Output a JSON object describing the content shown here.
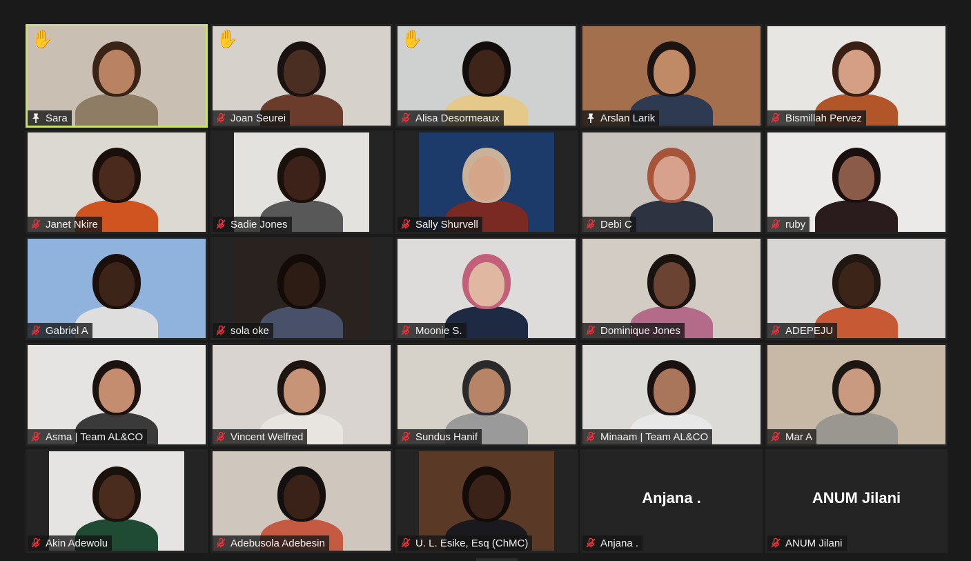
{
  "meeting": {
    "view": "Gallery View",
    "accent_speaking": "#c8e26a"
  },
  "participants": [
    {
      "name": "Sara",
      "status_icon": "pin-icon",
      "hand_raised": true,
      "speaking": true,
      "video": true,
      "bg": "#c9bfb3",
      "skin": "#b98262",
      "hair": "#3a2418",
      "shirt": "#8f7c64"
    },
    {
      "name": "Joan Seurei",
      "status_icon": "mic-muted-icon",
      "hand_raised": true,
      "speaking": false,
      "video": true,
      "bg": "#d6d2cb",
      "skin": "#4a2e22",
      "hair": "#1a1210",
      "shirt": "#6b3b2b"
    },
    {
      "name": "Alisa Desormeaux",
      "status_icon": "mic-muted-icon",
      "hand_raised": true,
      "speaking": false,
      "video": true,
      "bg": "#cfd1d1",
      "skin": "#3e2419",
      "hair": "#120c0a",
      "shirt": "#e4c98a"
    },
    {
      "name": "Arslan Larik",
      "status_icon": "pin-icon",
      "hand_raised": false,
      "speaking": false,
      "video": true,
      "bg": "#a46f4d",
      "skin": "#c08a66",
      "hair": "#1c1410",
      "shirt": "#2e3a52"
    },
    {
      "name": "Bismillah Pervez",
      "status_icon": "mic-muted-icon",
      "hand_raised": false,
      "speaking": false,
      "video": true,
      "bg": "#e8e6e3",
      "skin": "#d59f86",
      "hair": "#3a2014",
      "shirt": "#b2562a"
    },
    {
      "name": "Janet Nkire",
      "status_icon": "mic-muted-icon",
      "hand_raised": false,
      "speaking": false,
      "video": true,
      "bg": "#dcd8d2",
      "skin": "#4a2a1c",
      "hair": "#1a0f0b",
      "shirt": "#d0541f"
    },
    {
      "name": "Sadie Jones",
      "status_icon": "mic-muted-icon",
      "hand_raised": false,
      "speaking": false,
      "video": true,
      "narrow": true,
      "bg": "#e4e2de",
      "skin": "#3c2218",
      "hair": "#1a100c",
      "shirt": "#585858"
    },
    {
      "name": "Sally Shurvell",
      "status_icon": "mic-muted-icon",
      "hand_raised": false,
      "speaking": false,
      "video": true,
      "narrow": true,
      "bg": "#1c3a6a",
      "skin": "#d5a58a",
      "hair": "#c9b299",
      "shirt": "#7a2a22"
    },
    {
      "name": "Debi C",
      "status_icon": "mic-muted-icon",
      "hand_raised": false,
      "speaking": false,
      "video": true,
      "bg": "#c8c4bd",
      "skin": "#d8a18e",
      "hair": "#a6553a",
      "shirt": "#2d3340"
    },
    {
      "name": "ruby",
      "status_icon": "mic-muted-icon",
      "hand_raised": false,
      "speaking": false,
      "video": true,
      "bg": "#eceae8",
      "skin": "#8a5b49",
      "hair": "#1a0f0f",
      "shirt": "#2a1c1c"
    },
    {
      "name": "Gabriel A",
      "status_icon": "mic-muted-icon",
      "hand_raised": false,
      "speaking": false,
      "video": true,
      "bg": "#8fb3dc",
      "skin": "#3d2418",
      "hair": "#1a0f0b",
      "shirt": "#dedede"
    },
    {
      "name": "sola oke",
      "status_icon": "mic-muted-icon",
      "hand_raised": false,
      "speaking": false,
      "video": true,
      "narrow": true,
      "bg": "#2a221e",
      "skin": "#2d1c14",
      "hair": "#120b08",
      "shirt": "#48506a"
    },
    {
      "name": "Moonie S.",
      "status_icon": "mic-muted-icon",
      "hand_raised": false,
      "speaking": false,
      "video": true,
      "bg": "#dedcda",
      "skin": "#e0b7a1",
      "hair": "#c2607a",
      "shirt": "#1e2a44"
    },
    {
      "name": "Dominique Jones",
      "status_icon": "mic-muted-icon",
      "hand_raised": false,
      "speaking": false,
      "video": true,
      "bg": "#d2ccc4",
      "skin": "#6a4332",
      "hair": "#1a120e",
      "shirt": "#b46b8a"
    },
    {
      "name": "ADEPEJU",
      "status_icon": "mic-muted-icon",
      "hand_raised": false,
      "speaking": false,
      "video": true,
      "bg": "#d8d6d4",
      "skin": "#3c2418",
      "hair": "#201612",
      "shirt": "#c75a34"
    },
    {
      "name": "Asma | Team AL&CO",
      "status_icon": "mic-muted-icon",
      "hand_raised": false,
      "speaking": false,
      "video": true,
      "bg": "#e6e4e2",
      "skin": "#c48d70",
      "hair": "#1c1210",
      "shirt": "#3a3a3a"
    },
    {
      "name": "Vincent Welfred",
      "status_icon": "mic-muted-icon",
      "hand_raised": false,
      "speaking": false,
      "video": true,
      "bg": "#d9d4cf",
      "skin": "#c89478",
      "hair": "#1e1410",
      "shirt": "#e8e4e0"
    },
    {
      "name": "Sundus Hanif",
      "status_icon": "mic-muted-icon",
      "hand_raised": false,
      "speaking": false,
      "video": true,
      "bg": "#d6d2ca",
      "skin": "#b88468",
      "hair": "#2a2a2a",
      "shirt": "#9a9a9a"
    },
    {
      "name": "Minaam | Team AL&CO",
      "status_icon": "mic-muted-icon",
      "hand_raised": false,
      "speaking": false,
      "video": true,
      "bg": "#dcdad6",
      "skin": "#a9765c",
      "hair": "#1a1210",
      "shirt": "#e8e8e8"
    },
    {
      "name": "Mar A",
      "status_icon": "mic-muted-icon",
      "hand_raised": false,
      "speaking": false,
      "video": true,
      "bg": "#c8b9a6",
      "skin": "#c99a80",
      "hair": "#1e1612",
      "shirt": "#9a9690"
    },
    {
      "name": "Akin Adewolu",
      "status_icon": "mic-muted-icon",
      "hand_raised": false,
      "speaking": false,
      "video": true,
      "narrow": true,
      "bg": "#e6e4e2",
      "skin": "#4a2c1e",
      "hair": "#1a100c",
      "shirt": "#1f4a34"
    },
    {
      "name": "Adebusola Adebesin",
      "status_icon": "mic-muted-icon",
      "hand_raised": false,
      "speaking": false,
      "video": true,
      "bg": "#cfc6bd",
      "skin": "#3a2218",
      "hair": "#141010",
      "shirt": "#c55a42"
    },
    {
      "name": "U. L. Esike, Esq (ChMC)",
      "status_icon": "mic-muted-icon",
      "hand_raised": false,
      "speaking": false,
      "video": true,
      "narrow": true,
      "bg": "#5a3a26",
      "skin": "#3a2218",
      "hair": "#120b08",
      "shirt": "#1a1a1e"
    },
    {
      "name": "Anjana .",
      "status_icon": "mic-muted-icon",
      "hand_raised": false,
      "speaking": false,
      "video": false,
      "display_name": "Anjana ."
    },
    {
      "name": "ANUM Jilani",
      "status_icon": "mic-muted-icon",
      "hand_raised": false,
      "speaking": false,
      "video": false,
      "display_name": "ANUM Jilani"
    }
  ]
}
